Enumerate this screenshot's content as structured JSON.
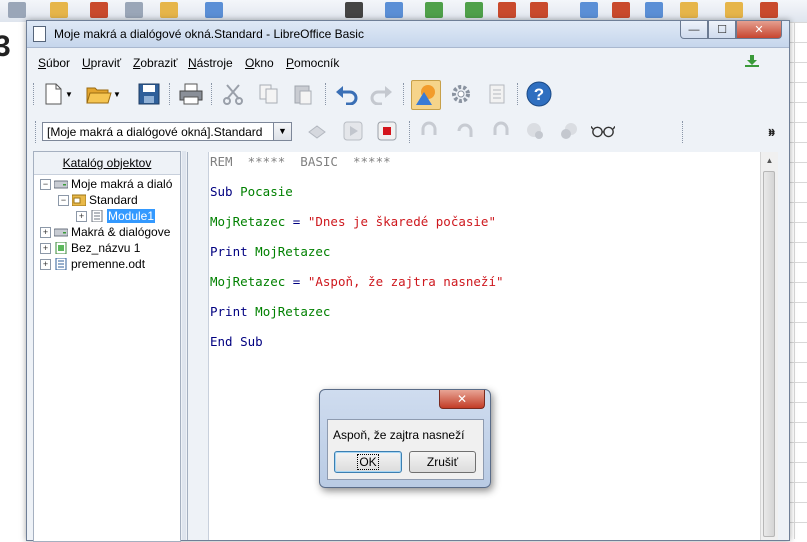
{
  "window": {
    "title": "Moje makrá a dialógové okná.Standard - LibreOffice Basic",
    "controls": {
      "minimize": "—",
      "maximize": "☐",
      "close": "✕"
    }
  },
  "menu": {
    "items": [
      {
        "label": "Súbor"
      },
      {
        "label": "Upraviť"
      },
      {
        "label": "Zobraziť"
      },
      {
        "label": "Nástroje"
      },
      {
        "label": "Okno"
      },
      {
        "label": "Pomocník"
      }
    ]
  },
  "toolbar": {
    "icons": [
      "new-document-icon",
      "open-folder-icon",
      "save-icon",
      "print-icon",
      "cut-icon",
      "copy-icon",
      "paste-icon",
      "undo-icon",
      "redo-icon",
      "shapes-icon",
      "settings-gear-icon",
      "macro-list-icon",
      "help-icon"
    ],
    "library_selector": "[Moje makrá a dialógové okná].Standard",
    "more_label": "»"
  },
  "catalog": {
    "heading": "Katalóg objektov",
    "nodes": [
      {
        "label": "Moje makrá a dialó",
        "expander": "⊟"
      },
      {
        "label": "Standard",
        "expander": "⊟"
      },
      {
        "label": "Module1",
        "expander": "⊞"
      },
      {
        "label": "Makrá & dialógove",
        "expander": "⊞"
      },
      {
        "label": "Bez_názvu 1",
        "expander": "⊞"
      },
      {
        "label": "premenne.odt",
        "expander": "⊞"
      }
    ]
  },
  "editor": {
    "line1": "REM  *****  BASIC  *****",
    "line2_kw": "Sub",
    "line2_id": "Pocasie",
    "line3_id": "MojRetazec",
    "line3_op": " = ",
    "line3_str": "\"Dnes je škaredé počasie\"",
    "line4_kw": "Print",
    "line4_id": "MojRetazec",
    "line5_id": "MojRetazec",
    "line5_op": " = ",
    "line5_str": "\"Aspoň, že zajtra nasneží\"",
    "line6_kw": "Print",
    "line6_id": "MojRetazec",
    "line7_kw": "End Sub"
  },
  "dialog": {
    "close_label": "✕",
    "message": "Aspoň, že zajtra nasneží",
    "ok_label": "OK",
    "cancel_label": "Zrušiť"
  },
  "background": {
    "big_text": "3"
  }
}
